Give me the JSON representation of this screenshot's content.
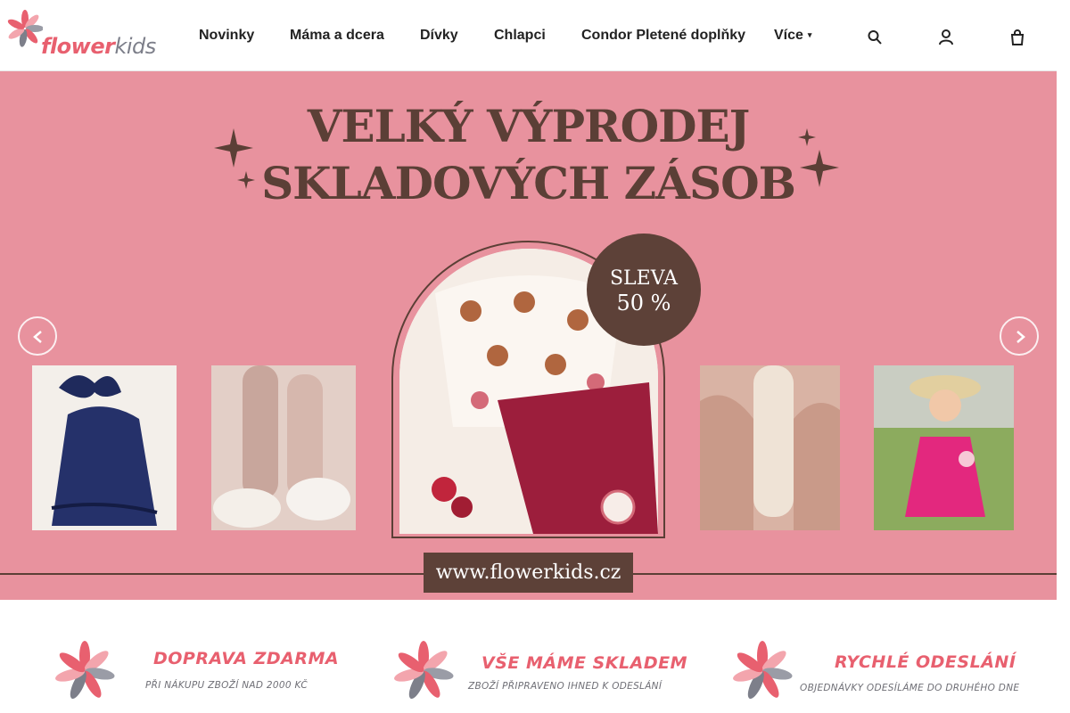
{
  "brand": {
    "logo_word_flower": "flower",
    "logo_word_kids": "kids",
    "colors": {
      "pink": "#e8606f",
      "grey": "#7d7f8a",
      "hero_bg": "#e8929e",
      "brown": "#5b3f36"
    }
  },
  "nav": {
    "items": [
      {
        "label": "Novinky"
      },
      {
        "label": "Máma a dcera"
      },
      {
        "label": "Dívky"
      },
      {
        "label": "Chlapci"
      },
      {
        "label": "Condor Pletené doplňky"
      },
      {
        "label": "Více"
      }
    ],
    "more_caret_icon": "chevron-down-icon"
  },
  "header_icons": [
    "search-icon",
    "user-icon",
    "cart-icon"
  ],
  "hero": {
    "title_line1": "VELKÝ VÝPRODEJ",
    "title_line2": "SKLADOVÝCH ZÁSOB",
    "badge_line1": "SLEVA",
    "badge_line2": "50 %",
    "url": "www.flowerkids.cz",
    "prev_icon": "chevron-left-icon",
    "next_icon": "chevron-right-icon"
  },
  "benefits": [
    {
      "title": "DOPRAVA ZDARMA",
      "subtitle": "PŘI NÁKUPU ZBOŽÍ NAD 2000 KČ"
    },
    {
      "title": "VŠE MÁME SKLADEM",
      "subtitle": "ZBOŽÍ PŘIPRAVENO IHNED K ODESLÁNÍ"
    },
    {
      "title": "RYCHLÉ ODESLÁNÍ",
      "subtitle": "OBJEDNÁVKY ODESÍLÁME DO DRUHÉHO DNE"
    }
  ]
}
